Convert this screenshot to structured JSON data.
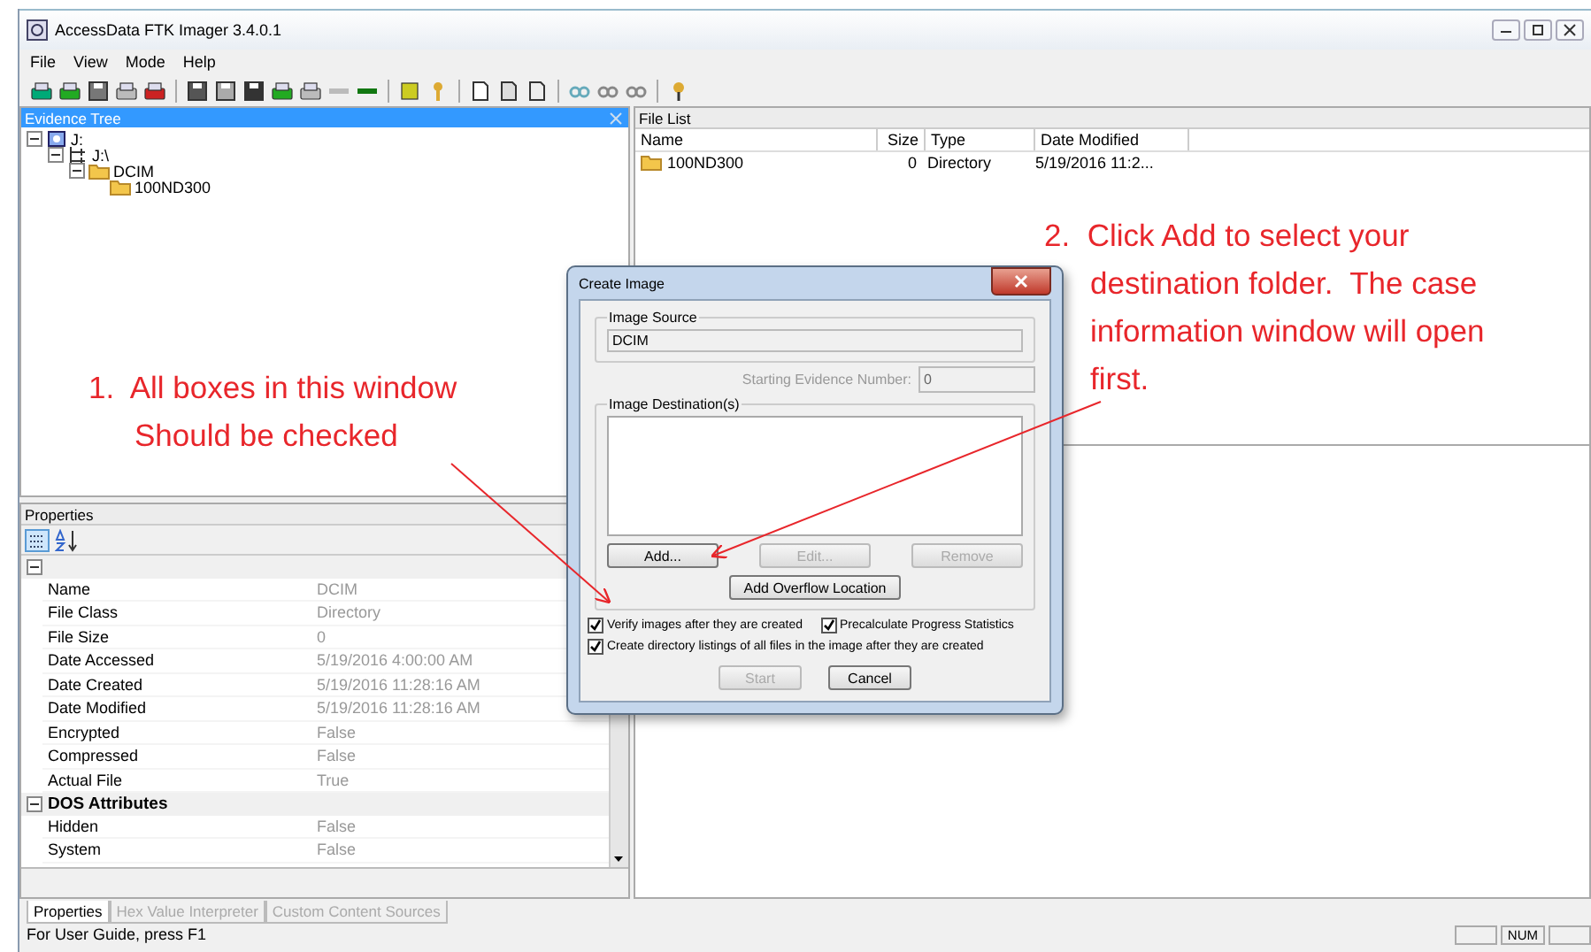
{
  "window": {
    "title": "AccessData FTK Imager 3.4.0.1"
  },
  "menu": [
    "File",
    "View",
    "Mode",
    "Help"
  ],
  "evidence_tree": {
    "title": "Evidence Tree",
    "nodes": [
      {
        "label": "J:",
        "expanded": true,
        "children": [
          {
            "label": "J:\\",
            "expanded": true,
            "children": [
              {
                "label": "DCIM",
                "expanded": true,
                "children": [
                  {
                    "label": "100ND300"
                  }
                ]
              }
            ]
          }
        ]
      }
    ]
  },
  "file_list": {
    "title": "File List",
    "columns": [
      "Name",
      "Size",
      "Type",
      "Date Modified"
    ],
    "rows": [
      {
        "name": "100ND300",
        "size": "0",
        "type": "Directory",
        "date_modified": "5/19/2016 11:2..."
      }
    ]
  },
  "properties": {
    "title": "Properties",
    "groups": [
      {
        "expanded": true,
        "rows": [
          {
            "name": "Name",
            "value": "DCIM"
          },
          {
            "name": "File Class",
            "value": "Directory"
          },
          {
            "name": "File Size",
            "value": "0"
          },
          {
            "name": "Date Accessed",
            "value": "5/19/2016 4:00:00 AM"
          },
          {
            "name": "Date Created",
            "value": "5/19/2016 11:28:16 AM"
          },
          {
            "name": "Date Modified",
            "value": "5/19/2016 11:28:16 AM"
          },
          {
            "name": "Encrypted",
            "value": "False"
          },
          {
            "name": "Compressed",
            "value": "False"
          },
          {
            "name": "Actual File",
            "value": "True"
          }
        ]
      },
      {
        "label": "DOS Attributes",
        "expanded": true,
        "rows": [
          {
            "name": "Hidden",
            "value": "False"
          },
          {
            "name": "System",
            "value": "False"
          }
        ]
      }
    ]
  },
  "tabs": [
    {
      "label": "Properties",
      "selected": true
    },
    {
      "label": "Hex Value Interpreter",
      "selected": false
    },
    {
      "label": "Custom Content Sources",
      "selected": false
    }
  ],
  "status_bar": {
    "text": "For User Guide, press F1",
    "indicator": "NUM"
  },
  "dialog": {
    "title": "Create Image",
    "image_source": {
      "label": "Image Source",
      "value": "DCIM"
    },
    "starting_evidence_number": {
      "label": "Starting Evidence Number:",
      "value": "0",
      "disabled": true
    },
    "image_destinations": {
      "label": "Image Destination(s)"
    },
    "buttons": [
      {
        "label": "Add...",
        "disabled": false
      },
      {
        "label": "Edit...",
        "disabled": true
      },
      {
        "label": "Remove",
        "disabled": true
      }
    ],
    "overflow_button": "Add Overflow Location",
    "options": [
      {
        "label": "Verify images after they are created",
        "checked": true
      },
      {
        "label": "Precalculate Progress Statistics",
        "checked": true
      },
      {
        "label": "Create directory listings of all files in the image after they are created",
        "checked": true
      }
    ],
    "actions": [
      {
        "label": "Start",
        "disabled": true
      },
      {
        "label": "Cancel",
        "disabled": false
      }
    ]
  },
  "annotations": [
    {
      "lines": [
        "1.  All boxes in this window",
        "Should be checked"
      ]
    },
    {
      "lines": [
        "2.  Click Add to select your",
        "destination folder.  The case",
        "information window will open",
        "first."
      ]
    }
  ]
}
